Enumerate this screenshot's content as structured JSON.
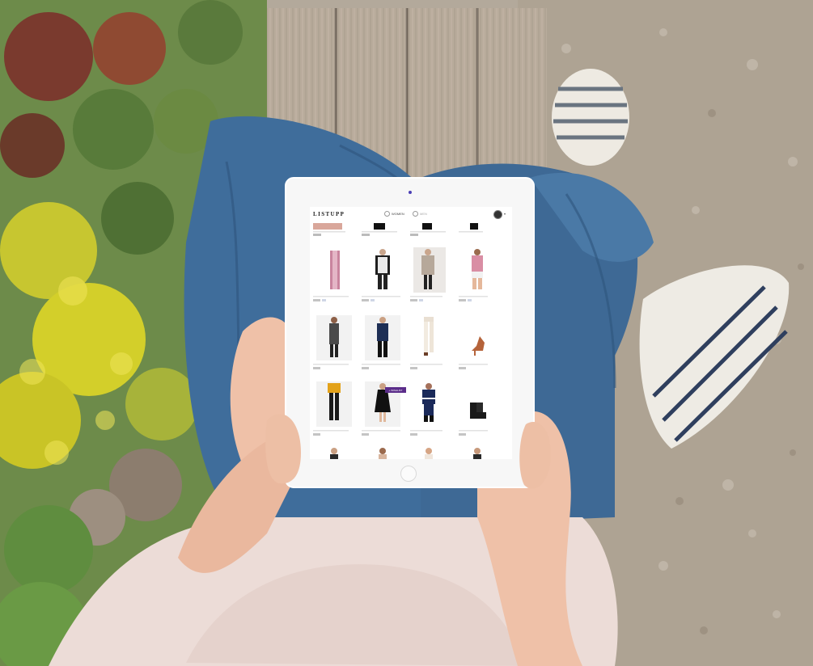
{
  "app": {
    "logo": "LISTUPP",
    "tabs": [
      {
        "label": "WOMEN",
        "icon": "circle-icon"
      },
      {
        "label": "MEN",
        "icon": "circle-icon"
      }
    ],
    "account_icon": "avatar-icon",
    "dropdown_icon": "chevron-down-icon"
  },
  "products": {
    "rows": [
      {
        "items": [
          "pants",
          "sweater",
          "dress-coat",
          "top"
        ]
      },
      {
        "items": [
          "dress",
          "blazer",
          "trousers",
          "heels"
        ]
      },
      {
        "items": [
          "yellow-top",
          "black-dress",
          "navy-sweater",
          "ankle-boots"
        ]
      },
      {
        "items": [
          "portrait",
          "portrait",
          "portrait",
          "portrait"
        ]
      }
    ],
    "add_button_label": "+ WISHLIST"
  },
  "colors": {
    "accent": "#5b2d8a",
    "denim": "#3f6d9b",
    "wood": "#b9ad9e",
    "gravel": "#b0a698"
  }
}
